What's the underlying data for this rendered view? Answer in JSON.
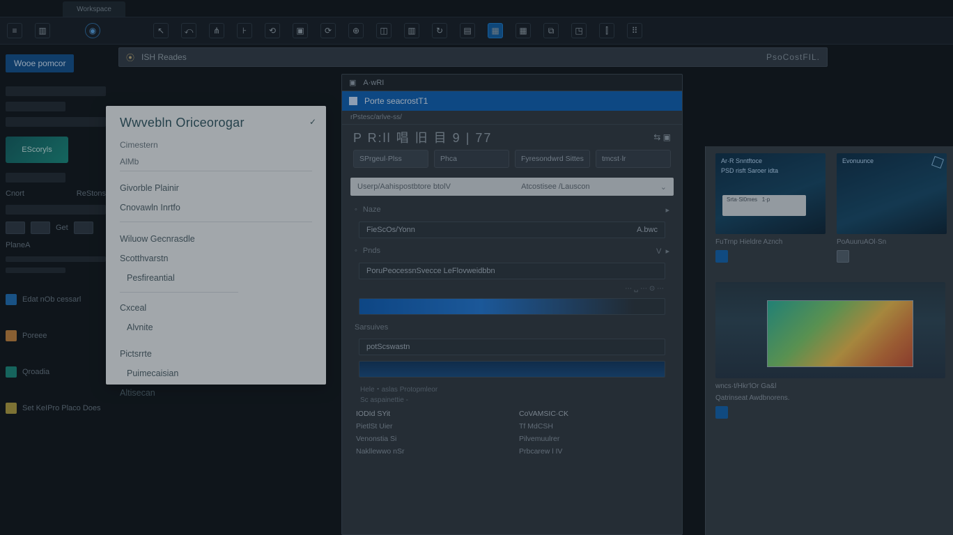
{
  "tabs": {
    "t1": "Workspace"
  },
  "addr": {
    "prefix": "⦿",
    "text": "ISH Reades",
    "right": "PsoCostFIL."
  },
  "leftBadge": "Wooe pomcor",
  "cardTeal": "EScoryls",
  "leftLabels": {
    "a": "Cnort",
    "b": "ReStons",
    "c": "Get",
    "d": "PlaneA",
    "e": "Edat nOb cessarl",
    "f": "Poreee",
    "g": "Qroadia",
    "h": "Set KeIPro Placo Does"
  },
  "popup": {
    "title": "Wwvebln Oriceorogar",
    "grp1": "Cimestern",
    "grp2": "AlMb",
    "items1": [
      "Givorble Plainir",
      "Cnovawln Inrtfo"
    ],
    "items2": [
      "Wiluow Gecnrasdle",
      "Scotthvarstn",
      "Pesfireantial"
    ],
    "items3": [
      "Cxceal",
      "Alvnite"
    ],
    "items4": [
      "Pictsrrte",
      "Puimecaisian",
      "Altisecan"
    ]
  },
  "dlg": {
    "tab": "A·wRI",
    "title": "Porte seacrostT1",
    "crumb": "rPstesc/arlve-ss/",
    "glyphs": "P  R:ll  唱  旧  目  9 | 77",
    "pills": [
      "SPrgeul·Plss",
      "Phca",
      "Fyresondwrd  Sittes",
      "tmcst·lr"
    ],
    "sub1": "Userp/Aahispostbtore btolV",
    "sub2": "Atcostisee /Lauscon",
    "sec1": "FieScOs/Yonn",
    "sec1r": "A.bwc",
    "sec2": "PoruPeocessnSvecce  LeFlovweidbbn",
    "prog": "",
    "secS": "Sarsuives",
    "fld2": "potScswastn",
    "fld3": "",
    "mini1": "Hele・aslas  Protopmleor",
    "mini2": "Sc aspainettie -",
    "colA": {
      "h": "IODId SYit",
      "a": "PietlSt  Uier",
      "b": "Venonstia Si",
      "c": "Nakllewwo nSr"
    },
    "colB": {
      "h": "CoVAMSIC·CK",
      "a": "Tf MdCSH",
      "b": "Pilvemuulrer",
      "c": "Prbcarew l IV"
    }
  },
  "gallery": {
    "t1": "Ar·R Snntftoce",
    "t1b": "PSD risft Saroer idta",
    "note1a": "Srta·Sl0mes",
    "note1b": "1·p",
    "t2": "Evonuunce",
    "cap1": "FuTrnp Hieldre Aznch",
    "cap2": "PoAuuruAOl·Sn",
    "bigcap1": "wncs·t/Hkr'lOr Ga&l",
    "bigcap2": "Qatrinseat Awdbnorens."
  }
}
